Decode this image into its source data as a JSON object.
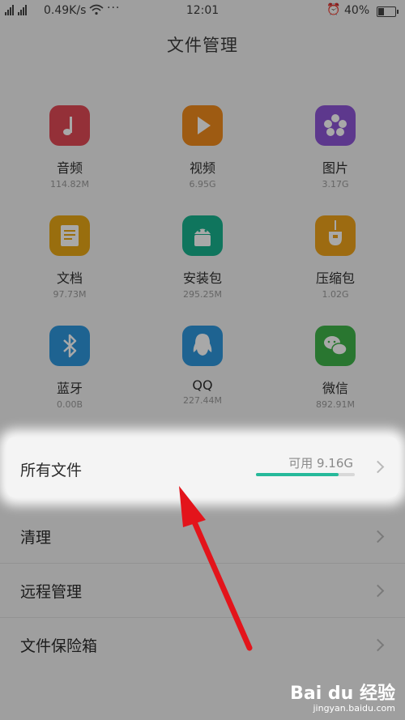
{
  "status": {
    "net_speed": "0.49K/s",
    "time": "12:01",
    "battery": "40%",
    "battery_level": 0.4
  },
  "title": "文件管理",
  "categories": [
    {
      "name": "音频",
      "size": "114.82M",
      "icon": "music-note-icon",
      "color": "#e14a55"
    },
    {
      "name": "视频",
      "size": "6.95G",
      "icon": "play-icon",
      "color": "#f08a1c"
    },
    {
      "name": "图片",
      "size": "3.17G",
      "icon": "flower-icon",
      "color": "#8e55d6"
    },
    {
      "name": "文档",
      "size": "97.73M",
      "icon": "document-icon",
      "color": "#e8a816"
    },
    {
      "name": "安装包",
      "size": "295.25M",
      "icon": "android-icon",
      "color": "#18b28e"
    },
    {
      "name": "压缩包",
      "size": "1.02G",
      "icon": "zip-icon",
      "color": "#eea31a"
    },
    {
      "name": "蓝牙",
      "size": "0.00B",
      "icon": "bluetooth-icon",
      "color": "#2e96dd"
    },
    {
      "name": "QQ",
      "size": "227.44M",
      "icon": "qq-icon",
      "color": "#2e96dd"
    },
    {
      "name": "微信",
      "size": "892.91M",
      "icon": "wechat-icon",
      "color": "#3fb34a"
    }
  ],
  "all_files": {
    "label": "所有文件",
    "available": "可用 9.16G",
    "used_fraction": 0.84,
    "accent": "#26b99a"
  },
  "menu": [
    {
      "label": "清理"
    },
    {
      "label": "远程管理"
    },
    {
      "label": "文件保险箱"
    }
  ],
  "watermark": {
    "brand": "Bai du 经验",
    "url": "jingyan.baidu.com"
  }
}
